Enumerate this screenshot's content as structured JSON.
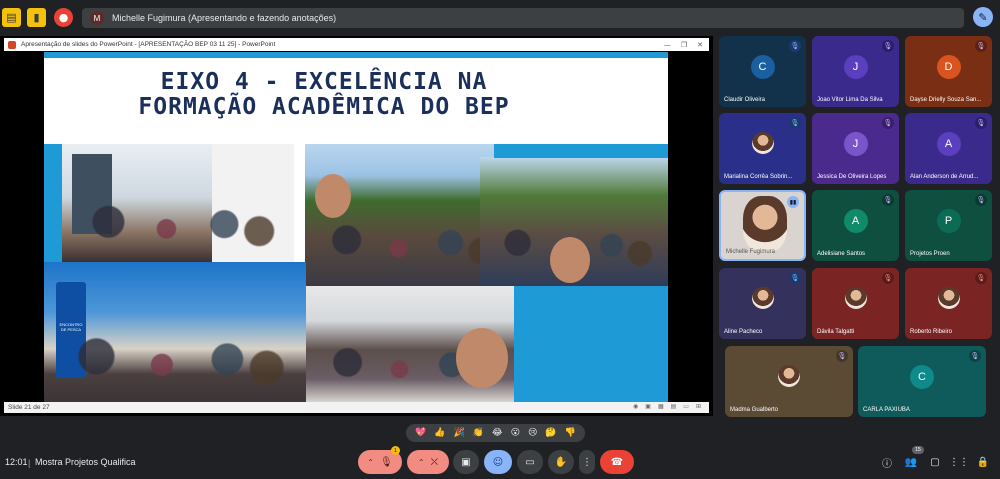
{
  "topbar": {
    "presenter_avatar_letter": "M",
    "presenter_text": "Michelle Fugimura (Apresentando e fazendo anotações)",
    "icons": [
      "whiteboard-icon",
      "notes-icon",
      "record-icon",
      "pen-icon"
    ]
  },
  "ppt": {
    "window_title": "Apresentação de slides do PowerPoint - [APRESENTAÇÃO BEP 03 11 25] - PowerPoint",
    "status": "Slide 21 de 27",
    "slide_title_line1": "EIXO 4 - EXCELÊNCIA NA",
    "slide_title_line2": "FORMAÇÃO ACADÊMICA DO BEP",
    "banner_text": "ENCONTRO DE PESCA"
  },
  "participants": [
    {
      "name": "Claudir Oliveira",
      "letter": "C",
      "bg": "#12314b",
      "avatar": "#1a5fa0",
      "mic": "blue"
    },
    {
      "name": "Joao Vitor Lima Da Silva",
      "letter": "J",
      "bg": "#3a2a8c",
      "avatar": "#5a3fbf",
      "mic": "dark"
    },
    {
      "name": "Dayse Drielly Souza San...",
      "letter": "D",
      "bg": "#7a2e14",
      "avatar": "#d9541e",
      "mic": "dark"
    },
    {
      "name": "Marialina Corrêa Sobrin...",
      "letter": "",
      "bg": "#2a2f8a",
      "avatar": "",
      "mic": "blue"
    },
    {
      "name": "Jessica De Oliveira Lopes",
      "letter": "J",
      "bg": "#4b2a8e",
      "avatar": "#7a55c9",
      "mic": "dark"
    },
    {
      "name": "Alan Anderson de Arrud...",
      "letter": "A",
      "bg": "#3a2a8c",
      "avatar": "#5a3fbf",
      "mic": "dark"
    },
    {
      "name": "Michelle Fugimura",
      "letter": "",
      "bg": "#d9d4cf",
      "avatar": "",
      "mic": "speaking"
    },
    {
      "name": "Adelisiane Santos",
      "letter": "A",
      "bg": "#0e4f40",
      "avatar": "#118a6a",
      "mic": "dark"
    },
    {
      "name": "Projetos Proen",
      "letter": "P",
      "bg": "#0e4f40",
      "avatar": "#0c6b55",
      "mic": "dark"
    },
    {
      "name": "Aline Pacheco",
      "letter": "",
      "bg": "#34325c",
      "avatar": "",
      "mic": "blue"
    },
    {
      "name": "Dávila Talgatti",
      "letter": "",
      "bg": "#7a2424",
      "avatar": "",
      "mic": "red"
    },
    {
      "name": "Roberto Ribeiro",
      "letter": "",
      "bg": "#7a2424",
      "avatar": "",
      "mic": "red"
    },
    {
      "name": "Madma Gualberto",
      "letter": "",
      "bg": "#5b4a34",
      "avatar": "",
      "mic": "dark"
    },
    {
      "name": "CARLA PAXIUBA",
      "letter": "C",
      "bg": "#0f5a5a",
      "avatar": "#0f8a8a",
      "mic": "dark"
    }
  ],
  "reactions": [
    "💖",
    "👍",
    "🎉",
    "👏",
    "😂",
    "😮",
    "😢",
    "🤔",
    "👎"
  ],
  "bottombar": {
    "time": "12:01",
    "separator": "|",
    "meeting_name": "Mostra Projetos Qualifica",
    "mic_badge": "1",
    "people_count": "15"
  }
}
